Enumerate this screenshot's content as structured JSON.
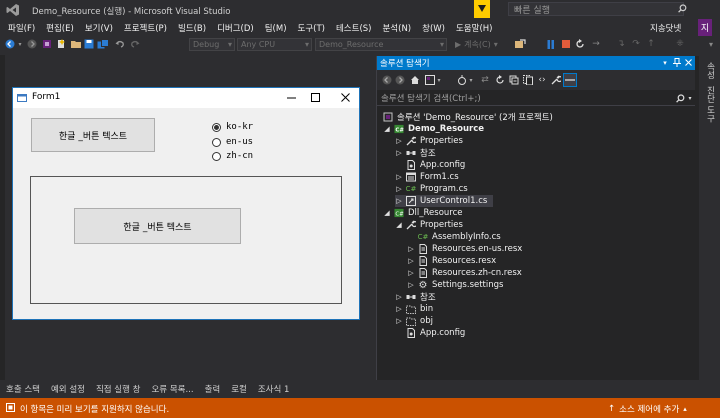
{
  "title_bar": {
    "title": "Demo_Resource (실행) - Microsoft Visual Studio",
    "quick_launch_placeholder": "빠른 실행",
    "user": "지송닷넷",
    "avatar_letter": "지"
  },
  "menu": [
    "파일(F)",
    "편집(E)",
    "보기(V)",
    "프로젝트(P)",
    "빌드(B)",
    "디버그(D)",
    "팀(M)",
    "도구(T)",
    "테스트(S)",
    "분석(N)",
    "창(W)",
    "도움말(H)"
  ],
  "toolbar": {
    "config": "Debug",
    "platform": "Any CPU",
    "startup_project": "Demo_Resource",
    "continue_label": "계속(C)"
  },
  "form1": {
    "title": "Form1",
    "button1": "한글 _버튼 텍스트",
    "button2": "한글 _버튼 텍스트",
    "radios": [
      {
        "label": "ko-kr",
        "checked": true
      },
      {
        "label": "en-us",
        "checked": false
      },
      {
        "label": "zh-cn",
        "checked": false
      }
    ]
  },
  "solution_explorer": {
    "title": "솔루션 탐색기",
    "search_placeholder": "솔루션 탐색기 검색(Ctrl+;)",
    "tree": [
      {
        "label": "솔루션 'Demo_Resource' (2개 프로젝트)",
        "icon": "solution-icon",
        "arrow": "",
        "indent": 0,
        "bold": false
      },
      {
        "label": "Demo_Resource",
        "icon": "csproj-icon",
        "arrow": "open",
        "indent": 0,
        "bold": true
      },
      {
        "label": "Properties",
        "icon": "wrench-icon",
        "arrow": "closed",
        "indent": 1
      },
      {
        "label": "참조",
        "icon": "references-icon",
        "arrow": "closed",
        "indent": 1
      },
      {
        "label": "App.config",
        "icon": "config-file-icon",
        "arrow": "",
        "indent": 1
      },
      {
        "label": "Form1.cs",
        "icon": "form-icon",
        "arrow": "closed",
        "indent": 1
      },
      {
        "label": "Program.cs",
        "icon": "cs-file-icon",
        "arrow": "closed",
        "indent": 1
      },
      {
        "label": "UserControl1.cs",
        "icon": "usercontrol-icon",
        "arrow": "closed",
        "indent": 1,
        "selected": true
      },
      {
        "label": "Dll_Resource",
        "icon": "csproj-icon",
        "arrow": "open",
        "indent": 0
      },
      {
        "label": "Properties",
        "icon": "wrench-icon",
        "arrow": "open",
        "indent": 1
      },
      {
        "label": "AssemblyInfo.cs",
        "icon": "cs-file-icon",
        "arrow": "",
        "indent": 2
      },
      {
        "label": "Resources.en-us.resx",
        "icon": "resx-icon",
        "arrow": "closed",
        "indent": 2
      },
      {
        "label": "Resources.resx",
        "icon": "resx-icon",
        "arrow": "closed",
        "indent": 2
      },
      {
        "label": "Resources.zh-cn.resx",
        "icon": "resx-icon",
        "arrow": "closed",
        "indent": 2
      },
      {
        "label": "Settings.settings",
        "icon": "settings-icon",
        "arrow": "closed",
        "indent": 2
      },
      {
        "label": "참조",
        "icon": "references-icon",
        "arrow": "closed",
        "indent": 1
      },
      {
        "label": "bin",
        "icon": "folder-icon",
        "arrow": "closed",
        "indent": 1
      },
      {
        "label": "obj",
        "icon": "folder-icon",
        "arrow": "closed",
        "indent": 1
      },
      {
        "label": "App.config",
        "icon": "config-file-icon",
        "arrow": "",
        "indent": 1
      }
    ]
  },
  "right_strip": [
    "속성",
    "진단 도구"
  ],
  "bottom_tabs": [
    "호출 스택",
    "예외 설정",
    "직접 실행 창",
    "오류 목록...",
    "출력",
    "로컬",
    "조사식 1"
  ],
  "status": {
    "message": "이 항목은 미리 보기를 지원하지 않습니다.",
    "source_control": "소스 제어에 추가"
  },
  "colors": {
    "accent": "#007acc",
    "status_bar": "#ca5100",
    "vs_logo": "#68217a"
  }
}
